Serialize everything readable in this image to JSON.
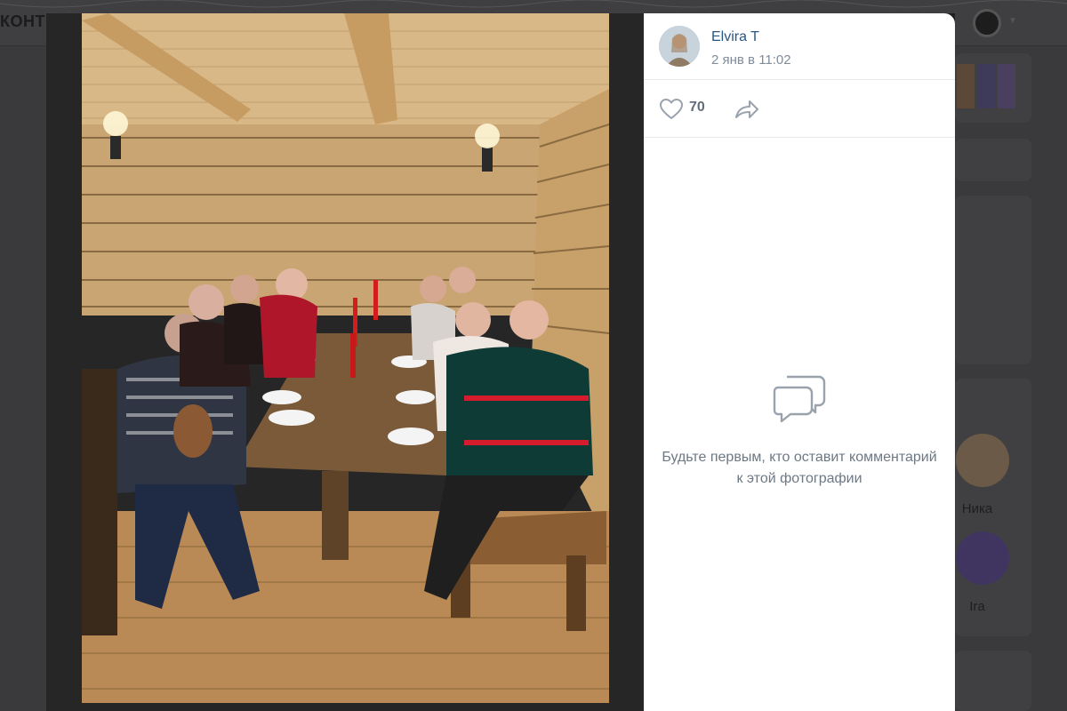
{
  "background": {
    "logo_text": "КОНТ",
    "friends": [
      {
        "name": "Ника"
      },
      {
        "name": "Ira"
      }
    ]
  },
  "post": {
    "author_name": "Elvira T",
    "date": "2 янв в 11:02",
    "likes": "70",
    "empty_comments_text": "Будьте первым, кто оставит комментарий к этой фотографии"
  },
  "icons": {
    "like": "heart-icon",
    "share": "share-icon",
    "comments": "comments-icon"
  },
  "colors": {
    "link": "#2a5885",
    "muted": "#818c99",
    "icon": "#99a2ad"
  }
}
